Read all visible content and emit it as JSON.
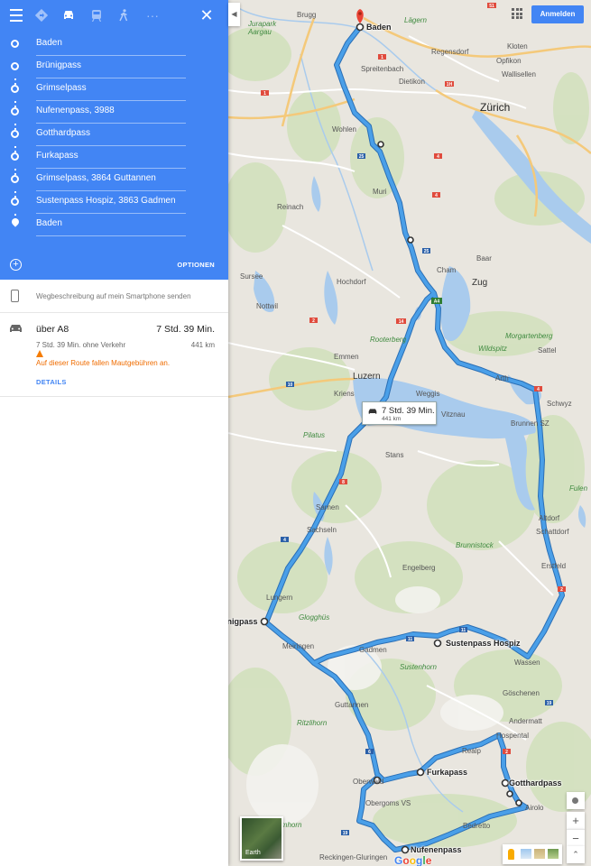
{
  "panel": {
    "modes": {
      "menu": "menu-icon",
      "best": "directions-icon",
      "car": "car-icon",
      "transit": "train-icon",
      "walk": "walk-icon",
      "more": "more-icon",
      "close": "close-icon"
    },
    "waypoints": [
      "Baden",
      "Brünigpass",
      "Grimselpass",
      "Nufenenpass, 3988",
      "Gotthardpass",
      "Furkapass",
      "Grimselpass, 3864 Guttannen",
      "Sustenpass Hospiz, 3863 Gadmen",
      "Baden"
    ],
    "options_label": "OPTIONEN",
    "send_to_phone": "Wegbeschreibung auf mein Smartphone senden",
    "route": {
      "via": "über A8",
      "duration": "7 Std. 39 Min.",
      "without_traffic": "7 Std. 39 Min. ohne Verkehr",
      "distance": "441 km",
      "toll_warning": "Auf dieser Route fallen Mautgebühren an.",
      "details_label": "DETAILS"
    }
  },
  "map": {
    "signin_label": "Anmelden",
    "route_box": {
      "duration": "7 Std. 39 Min.",
      "distance": "441 km"
    },
    "earth_label": "Earth",
    "google_logo": "Google",
    "colors": {
      "route": "#4a9fe8",
      "route_outline": "#2b6fb5",
      "accent": "#4285f4",
      "water": "#a9cbed",
      "forest": "#cfe0b9"
    },
    "stops": [
      "Baden",
      "Brünigpass",
      "Sustenpass Hospiz",
      "Furkapass",
      "Gotthardpass",
      "Nufenenpass"
    ],
    "labels": {
      "brugg": "Brugg",
      "lagern": "Lägern",
      "jurapark": "Jurapark\nAargau",
      "regensdorf": "Regensdorf",
      "kloten": "Kloten",
      "opfikon": "Opfikon",
      "wallisellen": "Wallisellen",
      "spreitenbach": "Spreitenbach",
      "dietikon": "Dietikon",
      "zurich": "Zürich",
      "wohlen": "Wohlen",
      "muri": "Muri",
      "reinach": "Reinach",
      "cham": "Cham",
      "baar": "Baar",
      "zug": "Zug",
      "sursee": "Sursee",
      "hochdorf": "Hochdorf",
      "nottwil": "Nottwil",
      "rooterberg": "Rooterberg",
      "morgartenberg": "Morgartenberg",
      "wildspitz": "Wildspitz",
      "sattel": "Sattel",
      "emmen": "Emmen",
      "luzern": "Luzern",
      "kriens": "Kriens",
      "weggis": "Weggis",
      "vitznau": "Vitznau",
      "arth": "Arth",
      "schwyz": "Schwyz",
      "brunnen": "Brunnen SZ",
      "pilatus": "Pilatus",
      "stans": "Stans",
      "fulen": "Fulen",
      "sarnen": "Sarnen",
      "sachseln": "Sachseln",
      "altdorf": "Altdorf",
      "schattdorf": "Schattdorf",
      "brunnistock": "Brunnistock",
      "engelberg": "Engelberg",
      "erstfeld": "Erstfeld",
      "lungern": "Lungern",
      "gloggus": "Glogghüs",
      "meiringen": "Meiringen",
      "gadmen": "Gadmen",
      "wassen": "Wassen",
      "sustenhorn": "Sustenhorn",
      "goschenen": "Göschenen",
      "guttannen": "Guttannen",
      "ritzlihorn": "Ritzlihorn",
      "andermatt": "Andermatt",
      "hospental": "Hospental",
      "realp": "Realp",
      "oberwald": "Oberwald",
      "obergoms": "Obergoms VS",
      "airolo": "Airolo",
      "bedretto": "Bedretto",
      "reckingen": "Reckingen-Gluringen",
      "lmhorn": "lmhorn"
    }
  }
}
